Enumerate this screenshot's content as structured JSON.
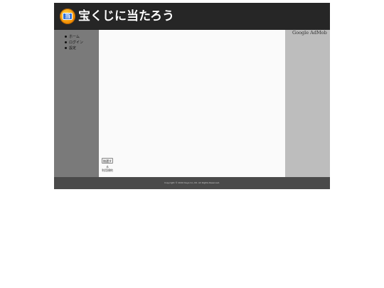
{
  "header": {
    "site_title": "宝くじに当たろう",
    "logo_glyph": "当"
  },
  "nav": {
    "items": [
      {
        "label": "ホーム"
      },
      {
        "label": "ログイン"
      },
      {
        "label": "設定"
      }
    ]
  },
  "main": {
    "button_label": "抽選する",
    "link_text": "利用規約"
  },
  "right_sidebar": {
    "ad_text": "Google AdMob"
  },
  "footer": {
    "copyright": "Copyright © 2020 Kaye Co.,ltd. All Rights Reserved."
  },
  "colors": {
    "header_bg": "#262626",
    "left_sidebar_bg": "#7a7a7a",
    "right_sidebar_bg": "#bdbdbd",
    "footer_bg": "#4a4a4a",
    "logo_accent": "#f08a00"
  }
}
